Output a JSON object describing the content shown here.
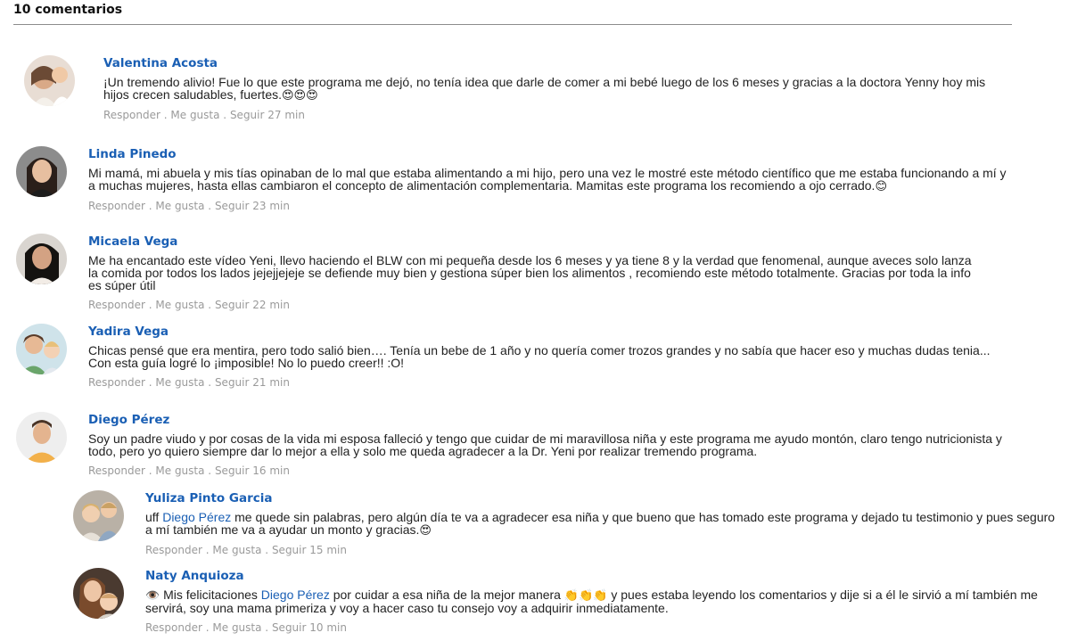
{
  "header": {
    "count_label": "10 comentarios"
  },
  "meta": {
    "reply": "Responder",
    "like": "Me gusta",
    "follow": "Seguir",
    "sep": " . "
  },
  "comments": [
    {
      "name": "Valentina Acosta",
      "text": "¡Un tremendo alivio! Fue lo que este programa me dejó, no tenía idea que darle de comer a mi bebé luego de los 6 meses y gracias a la doctora Yenny hoy mis hijos crecen saludables, fuertes.",
      "emoji": "😍😍😍",
      "time": "27 min"
    },
    {
      "name": "Linda Pinedo",
      "text": "Mi mamá, mi abuela y mis tías opinaban de lo mal que estaba alimentando a mi hijo, pero una vez le mostré este método científico que me estaba funcionando a mí y a muchas mujeres, hasta ellas cambiaron el concepto de alimentación complementaria. Mamitas este programa los recomiendo a ojo cerrado.",
      "emoji": "😊",
      "time": "23 min"
    },
    {
      "name": "Micaela Vega",
      "text": "Me ha encantado este vídeo Yeni, llevo haciendo el BLW con mi pequeña desde los 6 meses y ya tiene 8 y la verdad que fenomenal, aunque aveces solo lanza la comida por todos los lados jejejjejeje se defiende muy bien y gestiona súper bien los alimentos , recomiendo este método totalmente. Gracias por toda la info es súper útil",
      "time": "22 min"
    },
    {
      "name": "Yadira Vega",
      "text": "Chicas pensé que era mentira, pero todo salió bien…. Tenía un bebe de 1 año y no quería comer trozos grandes y no sabía que hacer eso y muchas dudas tenia... Con esta guía logré lo ¡imposible! No lo puedo creer!! :O!",
      "time": "21 min"
    },
    {
      "name": "Diego Pérez",
      "text": "Soy un padre viudo y por cosas de la vida mi esposa falleció y tengo que cuidar de mi maravillosa niña y este programa me ayudo montón, claro tengo nutricionista y todo, pero yo quiero siempre dar lo mejor a ella y solo me queda agradecer a la Dr. Yeni por realizar tremendo programa.",
      "time": "16 min"
    },
    {
      "name": "Yuliza Pinto Garcia",
      "prefix": "uff ",
      "mention": "Diego Pérez",
      "text": " me quede sin palabras, pero algún día te va a agradecer esa niña y que bueno que has tomado este programa y dejado tu testimonio y pues seguro a mí también me va a ayudar un monto y gracias.",
      "emoji": "😍",
      "time": "15 min"
    },
    {
      "name": "Naty Anquioza",
      "emoji_pre": "👁️",
      "prefix": " Mis felicitaciones ",
      "mention": "Diego Pérez",
      "text_a": " por cuidar a esa niña de la mejor manera ",
      "emoji_mid": "👏👏👏",
      "text_b": " y pues estaba leyendo los comentarios y dije si a él le sirvió a mí también me servirá, soy una mama primeriza y voy a hacer caso tu consejo voy a adquirir inmediatamente.",
      "time": "10 min"
    }
  ]
}
